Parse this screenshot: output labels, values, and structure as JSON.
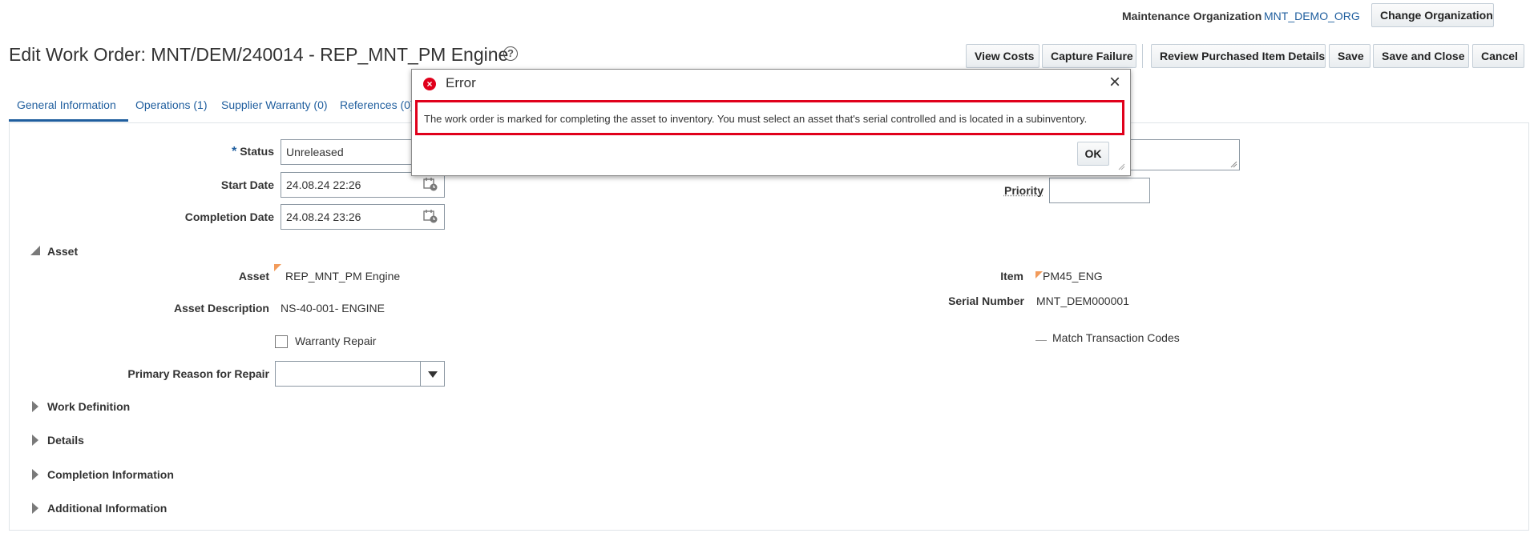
{
  "header": {
    "org_label": "Maintenance Organization",
    "org_value": "MNT_DEMO_ORG",
    "change_org_label": "Change Organization"
  },
  "page": {
    "title": "Edit Work Order: MNT/DEM/240014 - REP_MNT_PM Engine",
    "help_glyph": "?"
  },
  "toolbar": {
    "view_costs": "View Costs",
    "capture_failure": "Capture Failure",
    "review_purchased": "Review Purchased Item Details",
    "save": "Save",
    "save_close": "Save and Close",
    "cancel": "Cancel"
  },
  "tabs": [
    {
      "label": "General Information"
    },
    {
      "label": "Operations (1)"
    },
    {
      "label": "Supplier Warranty (0)"
    },
    {
      "label": "References (0)"
    }
  ],
  "form": {
    "required_mark": "*",
    "status_label": "Status",
    "status_value": "Unreleased",
    "start_date_label": "Start Date",
    "start_date_value": "24.08.24 22:26",
    "completion_date_label": "Completion Date",
    "completion_date_value": "24.08.24 23:26",
    "priority_label": "Priority",
    "priority_value": ""
  },
  "asset_section": {
    "title": "Asset",
    "asset_label": "Asset",
    "asset_value": "REP_MNT_PM Engine",
    "asset_desc_label": "Asset Description",
    "asset_desc_value": "NS-40-001- ENGINE",
    "warranty_repair_label": "Warranty Repair",
    "warranty_repair_checked": false,
    "primary_reason_label": "Primary Reason for Repair",
    "primary_reason_value": "",
    "item_label": "Item",
    "item_value": "PM45_ENG",
    "serial_label": "Serial Number",
    "serial_value": "MNT_DEM000001",
    "match_codes_label": "Match Transaction Codes"
  },
  "sections": [
    {
      "title": "Work Definition"
    },
    {
      "title": "Details"
    },
    {
      "title": "Completion Information"
    },
    {
      "title": "Additional Information"
    }
  ],
  "dialog": {
    "title": "Error",
    "message": "The work order is marked for completing the asset to inventory. You must select an asset that's serial controlled and is located in a subinventory.",
    "ok_label": "OK",
    "close_glyph": "×"
  },
  "colors": {
    "link": "#1f5e9e",
    "error_red": "#e0001b",
    "tab_underline": "#1f5e9e",
    "required_mark": "#1f5e9e",
    "orange_indicator": "#f29b5b"
  }
}
